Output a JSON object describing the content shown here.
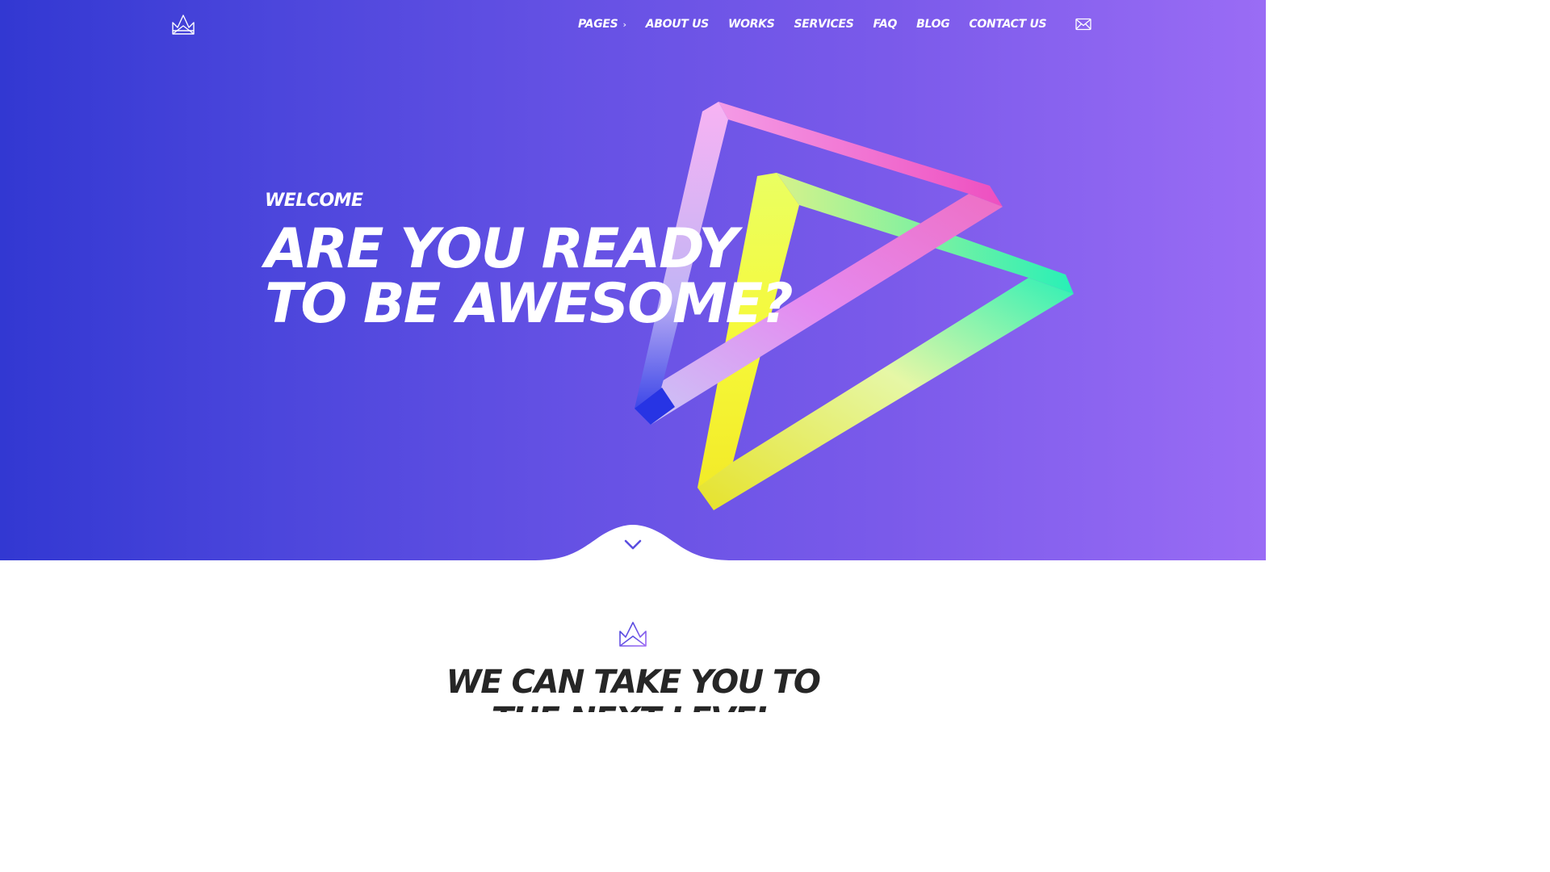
{
  "header": {
    "logo_icon": "crown-icon",
    "nav": [
      {
        "label": "PAGES",
        "has_submenu": true
      },
      {
        "label": "ABOUT US"
      },
      {
        "label": "WORKS"
      },
      {
        "label": "SERVICES"
      },
      {
        "label": "FAQ"
      },
      {
        "label": "BLOG"
      },
      {
        "label": "CONTACT US"
      }
    ],
    "mail_icon": "envelope-icon"
  },
  "hero": {
    "eyebrow": "WELCOME",
    "headline_line1": "ARE YOU READY",
    "headline_line2": "TO BE AWESOME?",
    "scroll_icon": "chevron-down-icon",
    "gradient_colors": [
      "#3238d2",
      "#6551e4",
      "#9a6cf5"
    ]
  },
  "intro": {
    "icon": "crown-icon",
    "title_line1": "WE CAN TAKE YOU TO",
    "title_line2": "THE NEXT LEVEL"
  },
  "colors": {
    "accent": "#5b4fe0",
    "text_dark": "#262626"
  }
}
